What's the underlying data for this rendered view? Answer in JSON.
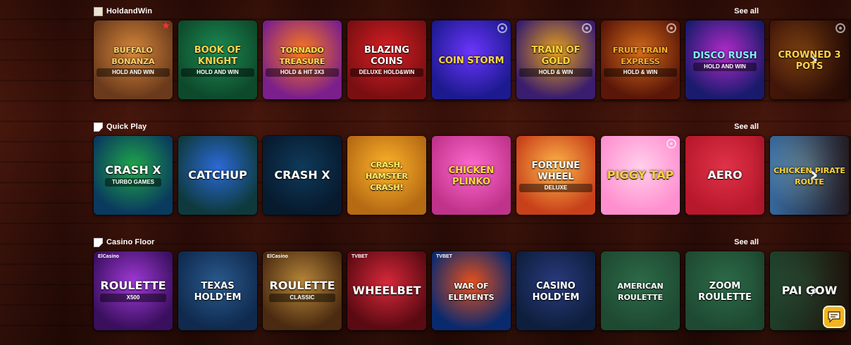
{
  "sections": [
    {
      "title": "HoldandWin",
      "see_all": "See all",
      "icon": "holdandwin-icon",
      "games": [
        {
          "title": "Buffalo Bonanza",
          "sub": "Hold and Win",
          "colors": [
            "#6b3a1c",
            "#d7883a"
          ],
          "text_color": "#ffd36b",
          "badge": "star"
        },
        {
          "title": "Book of Knight",
          "sub": "Hold and Win",
          "colors": [
            "#0d4a2c",
            "#1d8b52"
          ],
          "text_color": "#ffd44a",
          "badge": ""
        },
        {
          "title": "Tornado Treasure",
          "sub": "Hold & Hit 3x3",
          "colors": [
            "#7a1f8c",
            "#ff7a1a"
          ],
          "text_color": "#ffe14a",
          "badge": ""
        },
        {
          "title": "Blazing Coins",
          "sub": "Deluxe Hold&Win",
          "colors": [
            "#7a0f12",
            "#d81f24"
          ],
          "text_color": "#ffffff",
          "badge": ""
        },
        {
          "title": "Coin Storm",
          "sub": "",
          "colors": [
            "#1d1a8f",
            "#6b35ff"
          ],
          "text_color": "#ffd93b",
          "badge": "ring"
        },
        {
          "title": "Train of Gold",
          "sub": "Hold & Win",
          "colors": [
            "#3a1d6e",
            "#e8a21a"
          ],
          "text_color": "#ffd43b",
          "badge": "ring"
        },
        {
          "title": "Fruit Train Express",
          "sub": "Hold & Win",
          "colors": [
            "#5a1608",
            "#d46b1a"
          ],
          "text_color": "#ffb02a",
          "badge": "ring"
        },
        {
          "title": "Disco Rush",
          "sub": "Hold and Win",
          "colors": [
            "#1a1b6e",
            "#b12ac8"
          ],
          "text_color": "#7ff0ff",
          "badge": ""
        },
        {
          "title": "Crowned 3 Pots",
          "sub": "",
          "colors": [
            "#4a1a0a",
            "#c06a1a"
          ],
          "text_color": "#ffd24a",
          "badge": "ring"
        }
      ]
    },
    {
      "title": "Quick Play",
      "see_all": "See all",
      "icon": "broken-image-icon",
      "games": [
        {
          "title": "Crash X",
          "sub": "Turbo Games",
          "colors": [
            "#0a3a5e",
            "#1fa84a"
          ],
          "text_color": "#ffffff",
          "badge": ""
        },
        {
          "title": "Catchup",
          "sub": "",
          "colors": [
            "#0e3a3e",
            "#2b6ad8"
          ],
          "text_color": "#ffffff",
          "badge": ""
        },
        {
          "title": "Crash X",
          "sub": "",
          "colors": [
            "#071a2e",
            "#0f3a5a"
          ],
          "text_color": "#ffffff",
          "badge": ""
        },
        {
          "title": "Crash, Hamster Crash!",
          "sub": "",
          "colors": [
            "#b56a14",
            "#ffb42a"
          ],
          "text_color": "#fff06a",
          "badge": ""
        },
        {
          "title": "Chicken Plinko",
          "sub": "",
          "colors": [
            "#c0338a",
            "#ff6ad0"
          ],
          "text_color": "#ffd93b",
          "badge": ""
        },
        {
          "title": "Fortune Wheel",
          "sub": "Deluxe",
          "colors": [
            "#c8401a",
            "#ffb84a"
          ],
          "text_color": "#ffffff",
          "badge": ""
        },
        {
          "title": "Piggy Tap",
          "sub": "",
          "colors": [
            "#ff8fcf",
            "#ffd0ec"
          ],
          "text_color": "#ffd23b",
          "badge": "ring"
        },
        {
          "title": "Aero",
          "sub": "",
          "colors": [
            "#b8182c",
            "#e03248"
          ],
          "text_color": "#ffffff",
          "badge": ""
        },
        {
          "title": "Chicken Pirate Route",
          "sub": "",
          "colors": [
            "#3a7ab8",
            "#8ed0f0"
          ],
          "text_color": "#ffd43b",
          "badge": ""
        }
      ]
    },
    {
      "title": "Casino Floor",
      "see_all": "See all",
      "icon": "broken-image-icon",
      "games": [
        {
          "title": "Roulette",
          "sub": "X500",
          "provider": "ElCasino",
          "colors": [
            "#3a0f5e",
            "#a03ad8"
          ],
          "text_color": "#ffffff",
          "badge": ""
        },
        {
          "title": "Texas Hold'em",
          "sub": "",
          "provider": "",
          "colors": [
            "#0f2a4e",
            "#2a5a8e"
          ],
          "text_color": "#ffffff",
          "badge": ""
        },
        {
          "title": "Roulette",
          "sub": "Classic",
          "provider": "ElCasino",
          "colors": [
            "#4a2a10",
            "#b8883a"
          ],
          "text_color": "#ffffff",
          "badge": ""
        },
        {
          "title": "Wheelbet",
          "sub": "",
          "provider": "TVBET",
          "colors": [
            "#5a0a12",
            "#d8283a"
          ],
          "text_color": "#ffffff",
          "badge": ""
        },
        {
          "title": "War of Elements",
          "sub": "",
          "provider": "TVBET",
          "colors": [
            "#0a2a6e",
            "#e8501a"
          ],
          "text_color": "#ffffff",
          "badge": ""
        },
        {
          "title": "Casino Hold'em",
          "sub": "",
          "provider": "",
          "colors": [
            "#0e1f3e",
            "#2a3a7e"
          ],
          "text_color": "#ffffff",
          "badge": ""
        },
        {
          "title": "American Roulette",
          "sub": "",
          "provider": "",
          "colors": [
            "#1e4a32",
            "#2d6a48"
          ],
          "text_color": "#ffffff",
          "badge": ""
        },
        {
          "title": "Zoom Roulette",
          "sub": "",
          "provider": "",
          "colors": [
            "#1e4a32",
            "#2d6a48"
          ],
          "text_color": "#ffffff",
          "badge": ""
        },
        {
          "title": "Pai Gow",
          "sub": "",
          "provider": "",
          "colors": [
            "#1e4a32",
            "#2d6a48"
          ],
          "text_color": "#ffffff",
          "badge": ""
        }
      ]
    }
  ],
  "next_arrow": "›",
  "chat_button_icon": "chat-icon"
}
